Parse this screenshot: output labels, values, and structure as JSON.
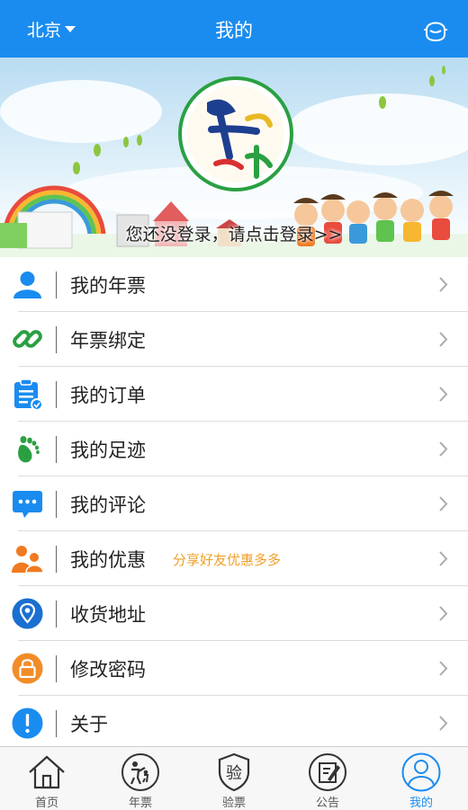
{
  "header": {
    "city": "北京",
    "title": "我的",
    "service_icon": "customer-service-icon"
  },
  "banner": {
    "login_prompt": "您还没登录，请点击登录>>",
    "logo_icon": "qinzi-nianpiao-logo"
  },
  "colors": {
    "primary": "#1a8cf0",
    "promo": "#f0a02a",
    "green": "#2aa042",
    "orange": "#f07a20"
  },
  "menu": [
    {
      "label": "我的年票",
      "icon": "user-icon"
    },
    {
      "label": "年票绑定",
      "icon": "link-icon"
    },
    {
      "label": "我的订单",
      "icon": "clipboard-icon"
    },
    {
      "label": "我的足迹",
      "icon": "footprint-icon"
    },
    {
      "label": "我的评论",
      "icon": "comment-icon"
    },
    {
      "label": "我的优惠",
      "icon": "family-icon",
      "hint": "分享好友优惠多多"
    },
    {
      "label": "收货地址",
      "icon": "location-icon"
    },
    {
      "label": "修改密码",
      "icon": "lock-icon"
    },
    {
      "label": "关于",
      "icon": "info-icon"
    }
  ],
  "tabs": [
    {
      "label": "首页",
      "icon": "home-icon"
    },
    {
      "label": "年票",
      "icon": "annual-ticket-icon"
    },
    {
      "label": "验票",
      "icon": "verify-ticket-icon",
      "badge_char": "验"
    },
    {
      "label": "公告",
      "icon": "notice-icon"
    },
    {
      "label": "我的",
      "icon": "profile-icon",
      "active": true
    }
  ]
}
